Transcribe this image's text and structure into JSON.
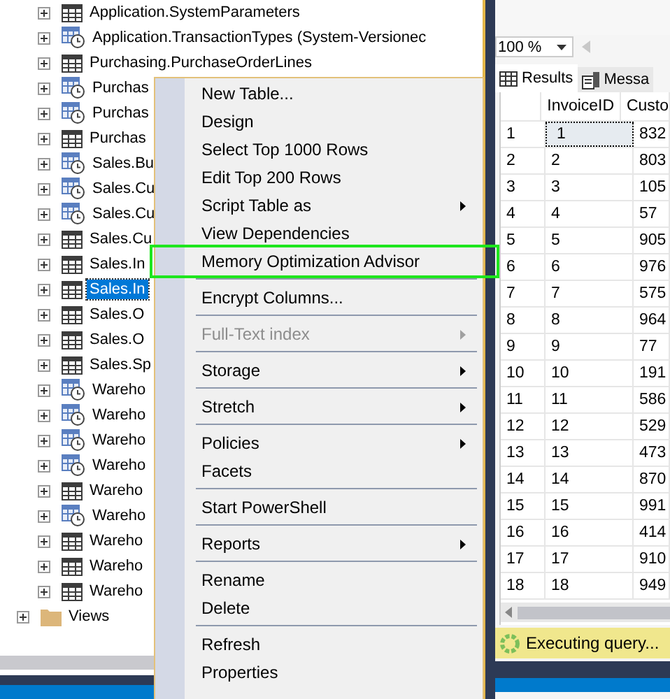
{
  "tree": {
    "items": [
      {
        "kind": "table",
        "label": "Application.SystemParameters",
        "selected": false
      },
      {
        "kind": "temporal",
        "label": "Application.TransactionTypes (System-Versionec",
        "selected": false
      },
      {
        "kind": "table",
        "label": "Purchasing.PurchaseOrderLines",
        "selected": false
      },
      {
        "kind": "temporal",
        "label": "Purchas",
        "selected": false
      },
      {
        "kind": "temporal",
        "label": "Purchas",
        "selected": false
      },
      {
        "kind": "table",
        "label": "Purchas",
        "selected": false
      },
      {
        "kind": "temporal",
        "label": "Sales.Bu",
        "selected": false
      },
      {
        "kind": "temporal",
        "label": "Sales.Cu",
        "selected": false
      },
      {
        "kind": "temporal",
        "label": "Sales.Cu",
        "selected": false
      },
      {
        "kind": "table",
        "label": "Sales.Cu",
        "selected": false
      },
      {
        "kind": "table",
        "label": "Sales.In",
        "selected": false
      },
      {
        "kind": "table",
        "label": "Sales.In",
        "selected": true
      },
      {
        "kind": "table",
        "label": "Sales.O",
        "selected": false
      },
      {
        "kind": "table",
        "label": "Sales.O",
        "selected": false
      },
      {
        "kind": "table",
        "label": "Sales.Sp",
        "selected": false
      },
      {
        "kind": "temporal",
        "label": "Wareho",
        "selected": false
      },
      {
        "kind": "temporal",
        "label": "Wareho",
        "selected": false
      },
      {
        "kind": "temporal",
        "label": "Wareho",
        "selected": false
      },
      {
        "kind": "temporal",
        "label": "Wareho",
        "selected": false
      },
      {
        "kind": "table",
        "label": "Wareho",
        "selected": false
      },
      {
        "kind": "temporal",
        "label": "Wareho",
        "selected": false
      },
      {
        "kind": "table",
        "label": "Wareho",
        "selected": false
      },
      {
        "kind": "table",
        "label": "Wareho",
        "selected": false
      },
      {
        "kind": "table",
        "label": "Wareho",
        "selected": false
      },
      {
        "kind": "folder",
        "label": "Views",
        "selected": false
      }
    ]
  },
  "context_menu": {
    "items": [
      {
        "kind": "item",
        "label": "New Table...",
        "submenu": false,
        "disabled": false,
        "highlighted": false
      },
      {
        "kind": "item",
        "label": "Design",
        "submenu": false,
        "disabled": false,
        "highlighted": false
      },
      {
        "kind": "item",
        "label": "Select Top 1000 Rows",
        "submenu": false,
        "disabled": false,
        "highlighted": false
      },
      {
        "kind": "item",
        "label": "Edit Top 200 Rows",
        "submenu": false,
        "disabled": false,
        "highlighted": false
      },
      {
        "kind": "item",
        "label": "Script Table as",
        "submenu": true,
        "disabled": false,
        "highlighted": false
      },
      {
        "kind": "item",
        "label": "View Dependencies",
        "submenu": false,
        "disabled": false,
        "highlighted": false
      },
      {
        "kind": "item",
        "label": "Memory Optimization Advisor",
        "submenu": false,
        "disabled": false,
        "highlighted": true
      },
      {
        "kind": "separator"
      },
      {
        "kind": "item",
        "label": "Encrypt Columns...",
        "submenu": false,
        "disabled": false,
        "highlighted": false
      },
      {
        "kind": "separator"
      },
      {
        "kind": "item",
        "label": "Full-Text index",
        "submenu": true,
        "disabled": true,
        "highlighted": false
      },
      {
        "kind": "separator"
      },
      {
        "kind": "item",
        "label": "Storage",
        "submenu": true,
        "disabled": false,
        "highlighted": false
      },
      {
        "kind": "separator"
      },
      {
        "kind": "item",
        "label": "Stretch",
        "submenu": true,
        "disabled": false,
        "highlighted": false
      },
      {
        "kind": "separator"
      },
      {
        "kind": "item",
        "label": "Policies",
        "submenu": true,
        "disabled": false,
        "highlighted": false
      },
      {
        "kind": "item",
        "label": "Facets",
        "submenu": false,
        "disabled": false,
        "highlighted": false
      },
      {
        "kind": "separator"
      },
      {
        "kind": "item",
        "label": "Start PowerShell",
        "submenu": false,
        "disabled": false,
        "highlighted": false
      },
      {
        "kind": "separator"
      },
      {
        "kind": "item",
        "label": "Reports",
        "submenu": true,
        "disabled": false,
        "highlighted": false
      },
      {
        "kind": "separator"
      },
      {
        "kind": "item",
        "label": "Rename",
        "submenu": false,
        "disabled": false,
        "highlighted": false
      },
      {
        "kind": "item",
        "label": "Delete",
        "submenu": false,
        "disabled": false,
        "highlighted": false
      },
      {
        "kind": "separator"
      },
      {
        "kind": "item",
        "label": "Refresh",
        "submenu": false,
        "disabled": false,
        "highlighted": false
      },
      {
        "kind": "item",
        "label": "Properties",
        "submenu": false,
        "disabled": false,
        "highlighted": false
      }
    ]
  },
  "results": {
    "zoom": "100 %",
    "tabs": [
      {
        "label": "Results",
        "selected": true
      },
      {
        "label": "Messa",
        "selected": false
      }
    ],
    "columns": [
      "InvoiceID",
      "Custo"
    ],
    "rows": [
      {
        "row": "1",
        "invoice_id": "1",
        "column_3": "832",
        "selected": true
      },
      {
        "row": "2",
        "invoice_id": "2",
        "column_3": "803",
        "selected": false
      },
      {
        "row": "3",
        "invoice_id": "3",
        "column_3": "105",
        "selected": false
      },
      {
        "row": "4",
        "invoice_id": "4",
        "column_3": "57",
        "selected": false
      },
      {
        "row": "5",
        "invoice_id": "5",
        "column_3": "905",
        "selected": false
      },
      {
        "row": "6",
        "invoice_id": "6",
        "column_3": "976",
        "selected": false
      },
      {
        "row": "7",
        "invoice_id": "7",
        "column_3": "575",
        "selected": false
      },
      {
        "row": "8",
        "invoice_id": "8",
        "column_3": "964",
        "selected": false
      },
      {
        "row": "9",
        "invoice_id": "9",
        "column_3": "77",
        "selected": false
      },
      {
        "row": "10",
        "invoice_id": "10",
        "column_3": "191",
        "selected": false
      },
      {
        "row": "11",
        "invoice_id": "11",
        "column_3": "586",
        "selected": false
      },
      {
        "row": "12",
        "invoice_id": "12",
        "column_3": "529",
        "selected": false
      },
      {
        "row": "13",
        "invoice_id": "13",
        "column_3": "473",
        "selected": false
      },
      {
        "row": "14",
        "invoice_id": "14",
        "column_3": "870",
        "selected": false
      },
      {
        "row": "15",
        "invoice_id": "15",
        "column_3": "991",
        "selected": false
      },
      {
        "row": "16",
        "invoice_id": "16",
        "column_3": "414",
        "selected": false
      },
      {
        "row": "17",
        "invoice_id": "17",
        "column_3": "910",
        "selected": false
      },
      {
        "row": "18",
        "invoice_id": "18",
        "column_3": "949",
        "selected": false
      }
    ],
    "status": "Executing query..."
  }
}
